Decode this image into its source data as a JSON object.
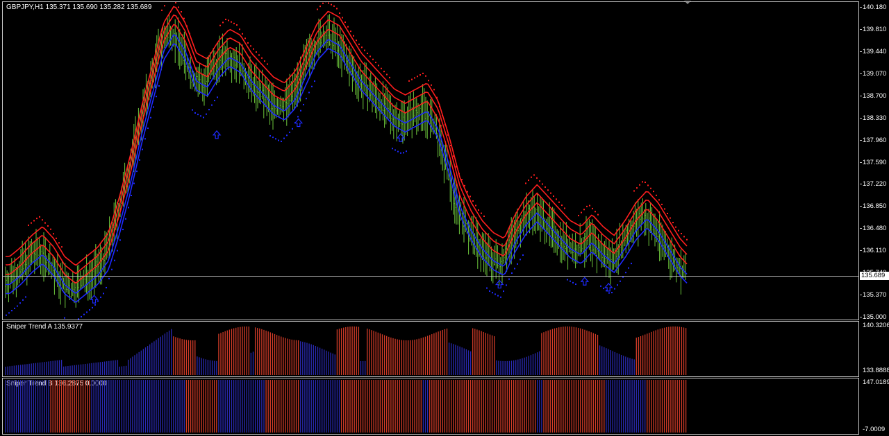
{
  "main": {
    "title": "GBPJPY,H1  135.371 135.690 135.282 135.689",
    "ticks": [
      "140.180",
      "139.810",
      "139.440",
      "139.070",
      "138.700",
      "138.330",
      "137.960",
      "137.590",
      "137.220",
      "136.850",
      "136.480",
      "136.110",
      "135.740",
      "135.370",
      "135.000"
    ],
    "current_price_label": "135.689",
    "current_price": 135.689,
    "range": [
      135.0,
      140.18
    ]
  },
  "sub1": {
    "title": "Sniper Trend A 135.9377",
    "ticks": [
      "140.3206",
      "133.8888"
    ]
  },
  "sub2": {
    "title": "Sniper Trend B 136.2875 0.0000",
    "ticks": [
      "147.0189",
      "-7.0009"
    ]
  },
  "colors": {
    "background": "#000000",
    "bull_bar": "#6ec83c",
    "upper_band": "#ff1e1e",
    "lower_band": "#1e2aff",
    "hist_blue": "#2a2ab4",
    "hist_red": "#d23c28",
    "border": "#c8c8c8"
  },
  "chart_data": {
    "type": "line",
    "symbol": "GBPJPY",
    "timeframe": "H1",
    "close_path": [
      135.6,
      135.75,
      135.95,
      136.1,
      135.9,
      135.6,
      135.45,
      135.6,
      135.75,
      136.0,
      136.6,
      137.3,
      138.1,
      138.8,
      139.5,
      139.8,
      139.5,
      139.0,
      138.9,
      139.2,
      139.4,
      139.3,
      139.0,
      138.8,
      138.6,
      138.5,
      138.7,
      139.1,
      139.5,
      139.7,
      139.6,
      139.3,
      139.0,
      138.8,
      138.6,
      138.4,
      138.3,
      138.4,
      138.5,
      138.2,
      137.6,
      136.9,
      136.5,
      136.2,
      136.0,
      135.9,
      136.3,
      136.6,
      136.8,
      136.6,
      136.4,
      136.2,
      136.1,
      136.3,
      136.1,
      135.95,
      136.2,
      136.5,
      136.7,
      136.5,
      136.2,
      135.9,
      135.7
    ],
    "zigzag_high": [
      135.0,
      136.15,
      135.55,
      139.95,
      138.5,
      139.9,
      138.4,
      138.3,
      136.8,
      137.05,
      136.05,
      136.3,
      135.75,
      136.85,
      135.69
    ],
    "up_arrows_count": 6
  }
}
